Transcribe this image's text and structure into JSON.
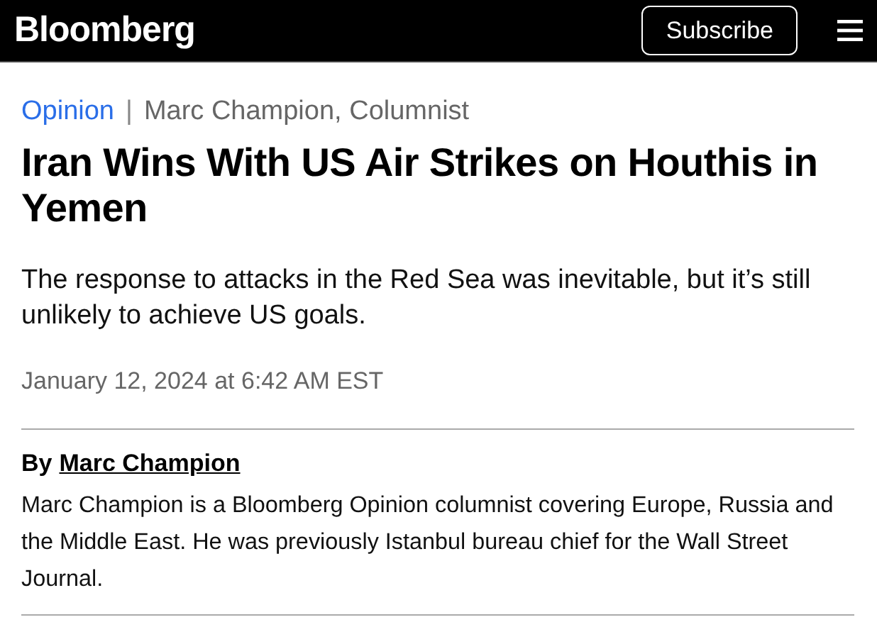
{
  "header": {
    "logo": "Bloomberg",
    "subscribe_button": "Subscribe"
  },
  "article": {
    "section": "Opinion",
    "separator": "|",
    "author_line": "Marc Champion, Columnist",
    "headline": "Iran Wins With US Air Strikes on Houthis in Yemen",
    "subheadline": "The response to attacks in the Red Sea was inevitable, but it’s still unlikely to achieve US goals.",
    "date": "January 12, 2024 at 6:42 AM EST",
    "byline": {
      "prefix": "By",
      "author": "Marc Champion"
    },
    "bio": "Marc Champion is a Bloomberg Opinion columnist covering Europe, Russia and the Middle East. He was previously Istanbul bureau chief for the Wall Street Journal."
  }
}
